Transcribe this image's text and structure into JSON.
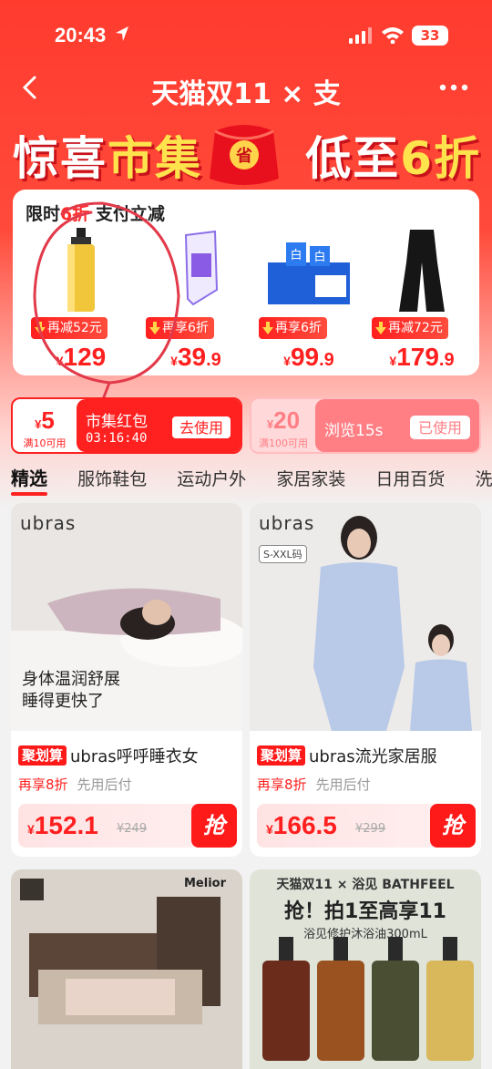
{
  "status_bar": {
    "time": "20:43",
    "battery": "33"
  },
  "nav": {
    "title": "天猫双11 × 支"
  },
  "banner": {
    "left_white": "惊喜",
    "left_yellow": "市集",
    "bag_label": "省",
    "right_white": "低至",
    "right_yellow": "6折"
  },
  "promo": {
    "title_pre": "限时",
    "title_hl": "6折",
    "title_post": " 支付立减",
    "items": [
      {
        "badge": "再减52元",
        "currency": "¥",
        "price_int": "129",
        "price_dec": ""
      },
      {
        "badge": "再享6折",
        "currency": "¥",
        "price_int": "39",
        "price_dec": ".9"
      },
      {
        "badge": "再享6折",
        "currency": "¥",
        "price_int": "99",
        "price_dec": ".9"
      },
      {
        "badge": "再减72元",
        "currency": "¥",
        "price_int": "179",
        "price_dec": ".9"
      }
    ]
  },
  "coupons": [
    {
      "currency": "¥",
      "amount": "5",
      "condition": "满10可用",
      "name": "市集红包",
      "timer": "03:16:40",
      "button": "去使用"
    },
    {
      "currency": "¥",
      "amount": "20",
      "condition": "满100可用",
      "name": "浏览15s",
      "button": "已使用"
    }
  ],
  "tabs": [
    "精选",
    "服饰鞋包",
    "运动户外",
    "家居家装",
    "日用百货",
    "洗"
  ],
  "products": [
    {
      "brand": "ubras",
      "overlay_line1": "身体温润舒展",
      "overlay_line2": "睡得更快了",
      "tag": "聚划算",
      "name": "ubras呼呼睡衣女",
      "discount": "再享8折",
      "pay": "先用后付",
      "currency": "¥",
      "price": "152.1",
      "old_price": "¥249",
      "grab": "抢"
    },
    {
      "brand": "ubras",
      "size_tag": "S-XXL码",
      "tag": "聚划算",
      "name": "ubras流光家居服",
      "discount": "再享8折",
      "pay": "先用后付",
      "currency": "¥",
      "price": "166.5",
      "old_price": "¥299",
      "grab": "抢"
    },
    {
      "brand": "Melior"
    },
    {
      "line1": "天猫双11 × 浴见 BATHFEEL",
      "line2": "抢！拍1至高享11",
      "line3": "浴见修护沐浴油300mL"
    }
  ]
}
